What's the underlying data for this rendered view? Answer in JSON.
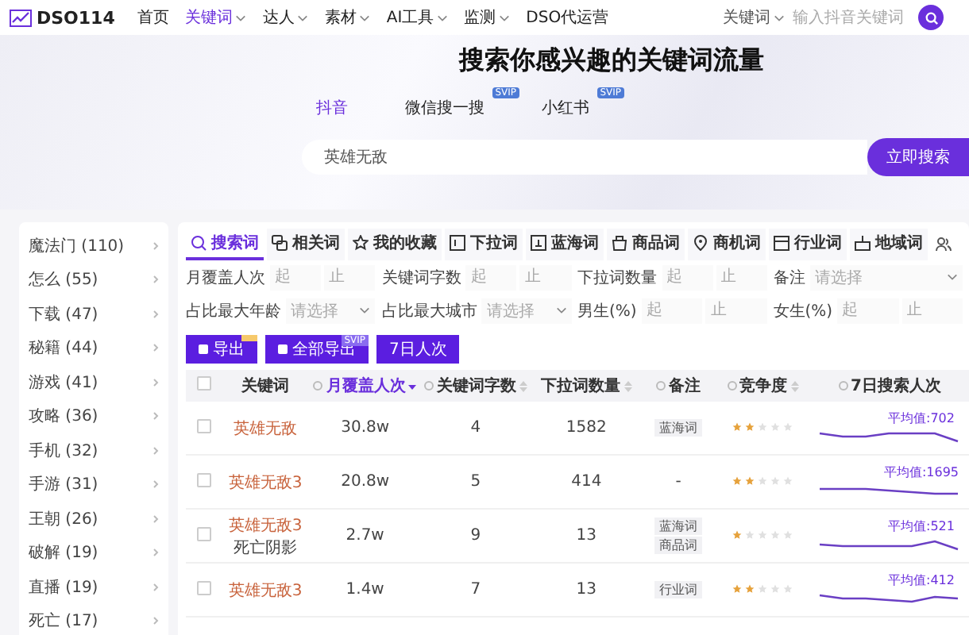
{
  "nav": {
    "logo": "DSO114",
    "items": [
      {
        "label": "首页",
        "dropdown": false,
        "selected": false
      },
      {
        "label": "关键词",
        "dropdown": true,
        "selected": true
      },
      {
        "label": "达人",
        "dropdown": true,
        "selected": false
      },
      {
        "label": "素材",
        "dropdown": true,
        "selected": false
      },
      {
        "label": "AI工具",
        "dropdown": true,
        "selected": false
      },
      {
        "label": "监测",
        "dropdown": true,
        "selected": false
      },
      {
        "label": "DSO代运营",
        "dropdown": false,
        "selected": false
      }
    ],
    "search_scope": "关键词",
    "search_placeholder": "输入抖音关键词"
  },
  "hero": {
    "title": "搜索你感兴趣的关键词流量",
    "platforms": [
      {
        "label": "抖音",
        "selected": true
      },
      {
        "label": "微信搜一搜",
        "selected": false,
        "badge": "SVIP"
      },
      {
        "label": "小红书",
        "selected": false,
        "badge": "SVIP"
      }
    ],
    "search_value": "英雄无敌",
    "search_button": "立即搜索"
  },
  "sidebar": {
    "items": [
      "魔法门 (110)",
      "怎么 (55)",
      "下载 (47)",
      "秘籍 (44)",
      "游戏 (41)",
      "攻略 (36)",
      "手机 (32)",
      "手游 (31)",
      "王朝 (26)",
      "破解 (19)",
      "直播 (19)",
      "死亡 (17)"
    ]
  },
  "tabs": [
    {
      "label": "搜索词",
      "selected": true
    },
    {
      "label": "相关词",
      "selected": false
    },
    {
      "label": "我的收藏",
      "selected": false
    },
    {
      "label": "下拉词",
      "selected": false
    },
    {
      "label": "蓝海词",
      "selected": false
    },
    {
      "label": "商品词",
      "selected": false
    },
    {
      "label": "商机词",
      "selected": false
    },
    {
      "label": "行业词",
      "selected": false
    },
    {
      "label": "地域词",
      "selected": false
    }
  ],
  "filters": [
    [
      {
        "kind": "range",
        "label": "月覆盖人次",
        "inputs": [
          {
            "placeholder": "起"
          },
          {
            "placeholder": "止"
          }
        ]
      },
      {
        "kind": "range",
        "label": "关键词字数",
        "inputs": [
          {
            "placeholder": "起"
          },
          {
            "placeholder": "止"
          }
        ]
      },
      {
        "kind": "range",
        "label": "下拉词数量",
        "inputs": [
          {
            "placeholder": "起"
          },
          {
            "placeholder": "止"
          }
        ]
      },
      {
        "kind": "select",
        "label": "备注",
        "placeholder": "请选择"
      }
    ],
    [
      {
        "kind": "select",
        "label": "占比最大年龄",
        "placeholder": "请选择"
      },
      {
        "kind": "select",
        "label": "占比最大城市",
        "placeholder": "请选择"
      },
      {
        "kind": "range",
        "label": "男生(%)",
        "inputs": [
          {
            "placeholder": "起"
          },
          {
            "placeholder": "止"
          }
        ]
      },
      {
        "kind": "range",
        "label": "女生(%)",
        "inputs": [
          {
            "placeholder": "起"
          },
          {
            "placeholder": "止"
          }
        ]
      }
    ]
  ],
  "actions": [
    {
      "label": "导出",
      "icon": true,
      "flag": true
    },
    {
      "label": "全部导出",
      "icon": true,
      "badge": "SVIP"
    },
    {
      "label": "7日人次",
      "icon": false,
      "flag": false
    }
  ],
  "table": {
    "select_all_checked": false,
    "columns": [
      {
        "label": "关键词",
        "help": false,
        "sortable": false,
        "sorted": false
      },
      {
        "label": "月覆盖人次",
        "help": true,
        "sortable": true,
        "sorted": true
      },
      {
        "label": "关键词字数",
        "help": true,
        "sortable": true,
        "sorted": false
      },
      {
        "label": "下拉词数量",
        "help": false,
        "sortable": true,
        "sorted": false
      },
      {
        "label": "备注",
        "help": true,
        "sortable": false,
        "sorted": false
      },
      {
        "label": "竞争度",
        "help": true,
        "sortable": true,
        "sorted": false
      },
      {
        "label": "7日搜索人次",
        "help": true,
        "sortable": false,
        "sorted": false
      }
    ],
    "rows": [
      {
        "checked": false,
        "keyword": [
          "英雄无敌"
        ],
        "monthly": "30.8w",
        "chars": "4",
        "dropdown": "1582",
        "notes": [
          "蓝海词"
        ],
        "stars": 2,
        "average": "平均值:702"
      },
      {
        "checked": false,
        "keyword": [
          "英雄无敌3"
        ],
        "monthly": "20.8w",
        "chars": "5",
        "dropdown": "414",
        "notes": [],
        "empty_note": "-",
        "stars": 2,
        "average": "平均值:1695"
      },
      {
        "checked": false,
        "keyword": [
          "英雄无敌3",
          "死亡阴影"
        ],
        "monthly": "2.7w",
        "chars": "9",
        "dropdown": "13",
        "notes": [
          "蓝海词",
          "商品词"
        ],
        "stars": 1,
        "average": "平均值:521"
      },
      {
        "checked": false,
        "keyword": [
          "英雄无敌3"
        ],
        "monthly": "1.4w",
        "chars": "7",
        "dropdown": "13",
        "notes": [
          "行业词"
        ],
        "stars": 2,
        "average": "平均值:412"
      }
    ]
  }
}
